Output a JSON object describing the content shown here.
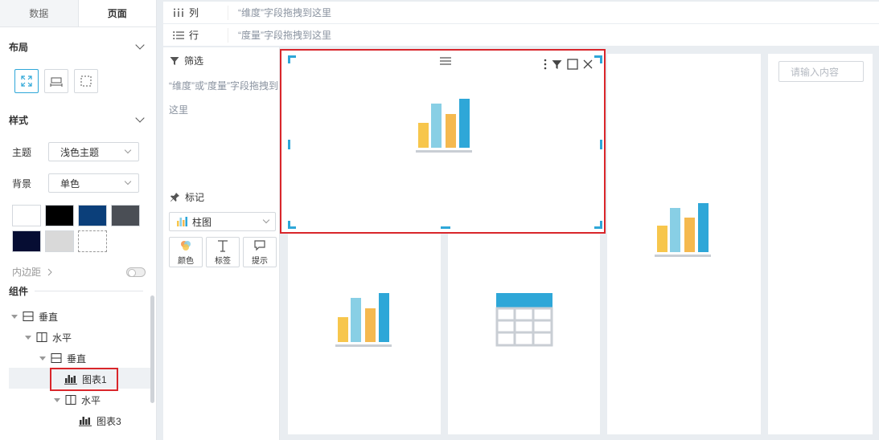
{
  "tabs": {
    "data": "数据",
    "page": "页面"
  },
  "layout": {
    "title": "布局"
  },
  "style": {
    "title": "样式",
    "theme_label": "主题",
    "theme_value": "浅色主题",
    "bg_label": "背景",
    "bg_value": "单色",
    "swatch_colors": [
      "#ffffff",
      "#000000",
      "#0b3f7a",
      "#4a4e55",
      "#060d33",
      "#d9d9d9",
      "#ffffff"
    ],
    "padding_label": "内边距"
  },
  "components": {
    "title": "组件",
    "tree": [
      {
        "label": "垂直",
        "icon": "vertical-layout-icon"
      },
      {
        "label": "水平",
        "icon": "horizontal-layout-icon"
      },
      {
        "label": "垂直",
        "icon": "vertical-layout-icon"
      },
      {
        "label": "图表1",
        "icon": "bar-chart-icon"
      },
      {
        "label": "水平",
        "icon": "horizontal-layout-icon"
      },
      {
        "label": "图表3",
        "icon": "bar-chart-icon"
      }
    ]
  },
  "columns": {
    "label": "列",
    "hint": "“维度”字段拖拽到这里"
  },
  "rows": {
    "label": "行",
    "hint": "“度量”字段拖拽到这里"
  },
  "filter": {
    "title": "筛选",
    "hint": "“维度”或“度量”字段拖拽到这里"
  },
  "marks": {
    "title": "标记",
    "chart_type": "柱图",
    "buttons": [
      "颜色",
      "标签",
      "提示"
    ]
  },
  "search": {
    "placeholder": "请输入内容"
  },
  "colors": {
    "accent": "#2ea7d8",
    "selected": "#d9262b",
    "bar_yellow": "#f7c64c",
    "bar_light": "#88cfe5",
    "bar_orange": "#f5b94f",
    "bar_blue": "#2ea7d8"
  }
}
